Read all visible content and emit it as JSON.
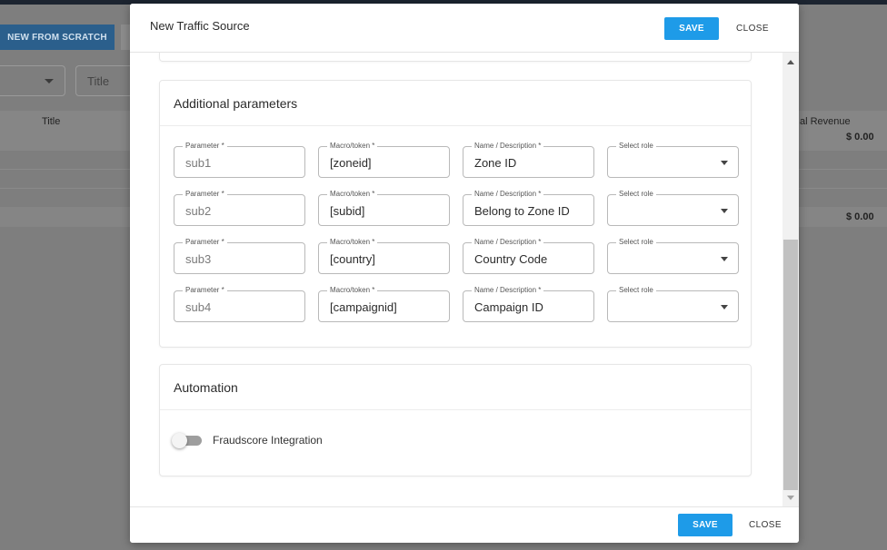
{
  "background": {
    "new_from_scratch_label": "NEW FROM SCRATCH",
    "title_filter_placeholder": "Title",
    "table": {
      "col_title": "Title",
      "col_revenue_partial": "al Revenue",
      "row1_revenue": "$ 0.00",
      "row2_revenue": "$ 0.00"
    }
  },
  "modal": {
    "title": "New Traffic Source",
    "save_label": "SAVE",
    "close_label": "CLOSE",
    "additional_parameters": {
      "title": "Additional parameters",
      "labels": {
        "parameter": "Parameter *",
        "macro": "Macro/token *",
        "name": "Name / Description *",
        "role": "Select role"
      },
      "rows": [
        {
          "parameter": "sub1",
          "macro": "[zoneid]",
          "name": "Zone ID",
          "role": ""
        },
        {
          "parameter": "sub2",
          "macro": "[subid]",
          "name": "Belong to Zone ID",
          "role": ""
        },
        {
          "parameter": "sub3",
          "macro": "[country]",
          "name": "Country Code",
          "role": ""
        },
        {
          "parameter": "sub4",
          "macro": "[campaignid]",
          "name": "Campaign ID",
          "role": ""
        }
      ]
    },
    "automation": {
      "title": "Automation",
      "fraudscore_label": "Fraudscore Integration",
      "fraudscore_enabled": false
    }
  },
  "colors": {
    "accent": "#1e9be8",
    "overlay": "#7e7e7e"
  }
}
